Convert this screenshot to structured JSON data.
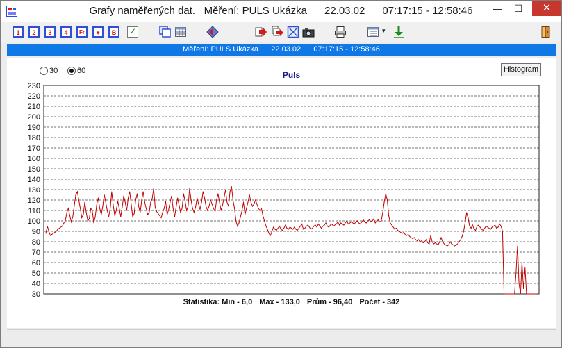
{
  "window": {
    "title": "Grafy naměřených dat.   Měření: PULS Ukázka      22.03.02      07:17:15 - 12:58:46",
    "min_glyph": "—",
    "max_glyph": "☐",
    "close_glyph": "✕"
  },
  "toolbar": {
    "buttons": [
      "1",
      "2",
      "3",
      "4",
      "Fr",
      "♥",
      "B"
    ],
    "check_glyph": "✓",
    "icons": [
      "copy-icon",
      "table-icon",
      "diamond-nav-icon",
      "export-arrow-icon",
      "export-multi-icon",
      "image-icon",
      "camera-icon",
      "print-icon",
      "list-icon",
      "download-icon",
      "exit-door-icon"
    ],
    "dropdown_glyph": "▾"
  },
  "banner": {
    "text": "Měření: PULS Ukázka      22.03.02      07:17:15 - 12:58:46"
  },
  "controls": {
    "radio_30": "30",
    "radio_60": "60",
    "selected_radio": "60",
    "histogram_button": "Histogram"
  },
  "colors": {
    "banner": "#0f78e6",
    "series": "#c00000",
    "title": "#1a1a8a",
    "close": "#c7372d"
  },
  "chart_data": {
    "type": "line",
    "title": "Puls",
    "ylim": [
      30,
      230
    ],
    "y_ticks": [
      30,
      40,
      50,
      60,
      70,
      80,
      90,
      100,
      110,
      120,
      130,
      140,
      150,
      160,
      170,
      180,
      190,
      200,
      210,
      220,
      230
    ],
    "grid": "horizontal dashed",
    "xlim": [
      0,
      342
    ],
    "series": [
      {
        "values": [
          88,
          95,
          90,
          86,
          87,
          88,
          89,
          90,
          92,
          93,
          94,
          95,
          98,
          100,
          108,
          112,
          105,
          99,
          104,
          115,
          125,
          128,
          120,
          112,
          103,
          106,
          118,
          108,
          100,
          102,
          112,
          110,
          98,
          104,
          116,
          122,
          112,
          106,
          114,
          125,
          118,
          110,
          104,
          112,
          128,
          115,
          105,
          110,
          119,
          112,
          104,
          113,
          124,
          118,
          110,
          122,
          128,
          116,
          104,
          107,
          120,
          126,
          114,
          108,
          120,
          128,
          118,
          112,
          106,
          108,
          118,
          121,
          131,
          113,
          109,
          107,
          105,
          103,
          108,
          112,
          119,
          106,
          111,
          118,
          124,
          112,
          104,
          113,
          122,
          115,
          108,
          112,
          126,
          119,
          110,
          114,
          131,
          120,
          112,
          108,
          113,
          122,
          116,
          111,
          118,
          128,
          122,
          114,
          110,
          114,
          120,
          116,
          112,
          109,
          120,
          126,
          118,
          110,
          115,
          122,
          130,
          118,
          114,
          128,
          133,
          120,
          112,
          100,
          95,
          98,
          104,
          110,
          118,
          106,
          112,
          118,
          125,
          118,
          114,
          116,
          120,
          116,
          112,
          110,
          112,
          105,
          100,
          95,
          92,
          88,
          86,
          90,
          94,
          92,
          91,
          93,
          95,
          92,
          91,
          93,
          96,
          93,
          92,
          94,
          93,
          92,
          94,
          92,
          91,
          93,
          95,
          97,
          92,
          93,
          95,
          96,
          94,
          92,
          93,
          95,
          96,
          94,
          97,
          95,
          93,
          95,
          96,
          98,
          95,
          94,
          96,
          97,
          95,
          96,
          97,
          99,
          96,
          98,
          97,
          96,
          98,
          100,
          97,
          98,
          99,
          98,
          97,
          99,
          100,
          98,
          97,
          99,
          101,
          99,
          98,
          100,
          101,
          99,
          100,
          102,
          98,
          100,
          101,
          99,
          100,
          108,
          118,
          126,
          120,
          105,
          98,
          96,
          94,
          92,
          93,
          91,
          90,
          89,
          88,
          89,
          87,
          86,
          87,
          85,
          84,
          83,
          84,
          82,
          81,
          82,
          80,
          81,
          79,
          80,
          82,
          79,
          78,
          86,
          80,
          78,
          79,
          78,
          77,
          80,
          84,
          80,
          78,
          77,
          76,
          77,
          80,
          78,
          77,
          76,
          77,
          78,
          80,
          82,
          85,
          90,
          98,
          108,
          103,
          95,
          93,
          96,
          92,
          91,
          95,
          96,
          94,
          92,
          91,
          93,
          95,
          94,
          93,
          92,
          94,
          95,
          96,
          93,
          94,
          97,
          95,
          90,
          30,
          12,
          2,
          0,
          0,
          0,
          2,
          8,
          50,
          76,
          40,
          30,
          60,
          35,
          55,
          25,
          10,
          5,
          0,
          0,
          0,
          0,
          0
        ]
      }
    ],
    "stats": {
      "min": "Statistika: Min - 6,0",
      "max": "Max - 133,0",
      "avg": "Prům - 96,40",
      "count": "Počet - 342"
    }
  }
}
